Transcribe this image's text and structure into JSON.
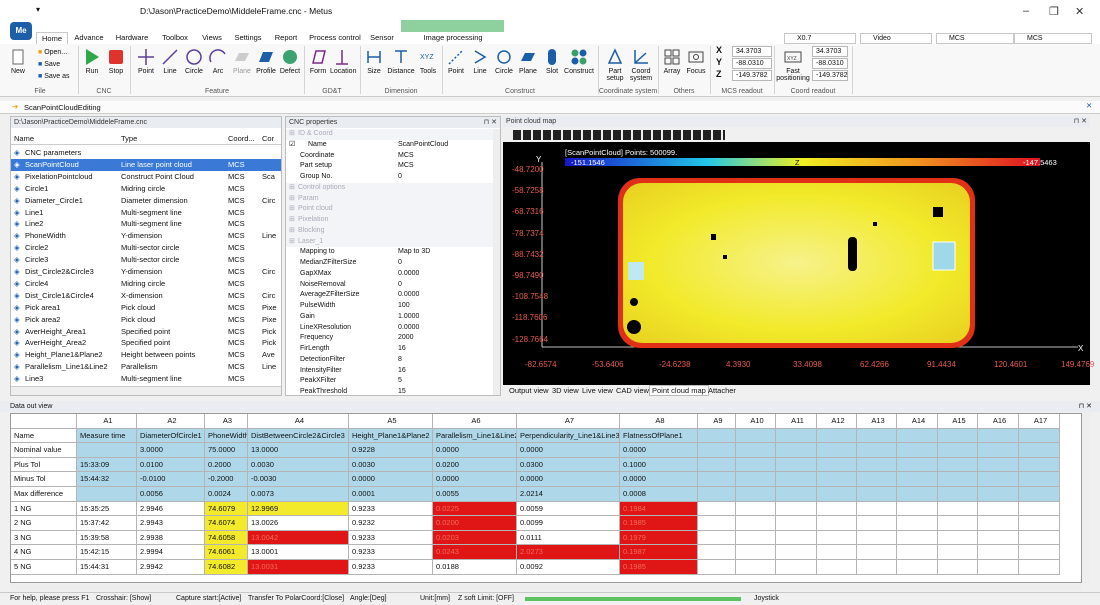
{
  "window": {
    "title": "D:\\Jason\\PracticeDemo\\MiddeleFrame.cnc - Metus",
    "logo": "Me"
  },
  "ribbon_tabs": [
    "Home",
    "Advance",
    "Hardware",
    "Toolbox",
    "Views",
    "Settings",
    "Report",
    "Process control",
    "Sensor",
    "Image processing parameters"
  ],
  "ribbon_groups": {
    "file": {
      "label": "File",
      "buttons": [
        "New",
        "Open...",
        "Save",
        "Save as"
      ]
    },
    "cnc": {
      "label": "CNC",
      "buttons": [
        "Run",
        "Stop"
      ]
    },
    "feature": {
      "label": "Feature",
      "buttons": [
        "Point",
        "Line",
        "Circle",
        "Arc",
        "Plane",
        "Profile",
        "Defect"
      ]
    },
    "gdt": {
      "label": "GD&T",
      "buttons": [
        "Form",
        "Location"
      ]
    },
    "dimension": {
      "label": "Dimension",
      "buttons": [
        "Size",
        "Distance",
        "Tools"
      ]
    },
    "construct": {
      "label": "Construct",
      "buttons": [
        "Point",
        "Line",
        "Circle",
        "Plane",
        "Slot",
        "Construct"
      ]
    },
    "coord": {
      "label": "Coordinate system",
      "buttons": [
        "Part setup",
        "Coord system"
      ]
    },
    "others": {
      "label": "Others",
      "buttons": [
        "Array",
        "Focus"
      ]
    },
    "mcs_readout": {
      "label": "MCS readout",
      "x": "34.3703",
      "y": "-88.0310",
      "z": "-149.3782"
    },
    "coord_readout": {
      "label": "Coord readout",
      "button": "Fast positioning",
      "x": "34.3703",
      "y": "-88.0310",
      "z": "-149.3782"
    }
  },
  "top_selects": {
    "zoom": "X0.7",
    "video": "Video",
    "mcs1": "MCS",
    "mcs2": "MCS"
  },
  "toolbar_item": "ScanPointCloudEditing",
  "tree": {
    "path": "D:\\Jason\\PracticeDemo\\MiddeleFrame.cnc",
    "headers": [
      "Name",
      "Type",
      "Coord...",
      "Cor"
    ],
    "rows": [
      {
        "name": "CNC parameters",
        "type": "",
        "coord": "",
        "cor": ""
      },
      {
        "name": "ScanPointCloud",
        "type": "Line laser point cloud",
        "coord": "MCS",
        "cor": ""
      },
      {
        "name": "PixelationPointcloud",
        "type": "Construct Point Cloud",
        "coord": "MCS",
        "cor": "Sca"
      },
      {
        "name": "Circle1",
        "type": "Midring circle",
        "coord": "MCS",
        "cor": ""
      },
      {
        "name": "Diameter_Circle1",
        "type": "Diameter dimension",
        "coord": "MCS",
        "cor": "Circ"
      },
      {
        "name": "Line1",
        "type": "Multi-segment line",
        "coord": "MCS",
        "cor": ""
      },
      {
        "name": "Line2",
        "type": "Multi-segment line",
        "coord": "MCS",
        "cor": ""
      },
      {
        "name": "PhoneWidth",
        "type": "Y-dimension",
        "coord": "MCS",
        "cor": "Line"
      },
      {
        "name": "Circle2",
        "type": "Multi-sector circle",
        "coord": "MCS",
        "cor": ""
      },
      {
        "name": "Circle3",
        "type": "Multi-sector circle",
        "coord": "MCS",
        "cor": ""
      },
      {
        "name": "Dist_Circle2&Circle3",
        "type": "Y-dimension",
        "coord": "MCS",
        "cor": "Circ"
      },
      {
        "name": "Circle4",
        "type": "Midring circle",
        "coord": "MCS",
        "cor": ""
      },
      {
        "name": "Dist_Circle1&Circle4",
        "type": "X-dimension",
        "coord": "MCS",
        "cor": "Circ"
      },
      {
        "name": "Pick area1",
        "type": "Pick cloud",
        "coord": "MCS",
        "cor": "Pixe"
      },
      {
        "name": "Pick area2",
        "type": "Pick cloud",
        "coord": "MCS",
        "cor": "Pixe"
      },
      {
        "name": "AverHeight_Area1",
        "type": "Specified point",
        "coord": "MCS",
        "cor": "Pick"
      },
      {
        "name": "AverHeight_Area2",
        "type": "Specified point",
        "coord": "MCS",
        "cor": "Pick"
      },
      {
        "name": "Height_Plane1&Plane2",
        "type": "Height between points",
        "coord": "MCS",
        "cor": "Ave"
      },
      {
        "name": "Parallelism_Line1&Line2",
        "type": "Parallelism",
        "coord": "MCS",
        "cor": "Line"
      },
      {
        "name": "Line3",
        "type": "Multi-segment line",
        "coord": "MCS",
        "cor": ""
      }
    ]
  },
  "props": {
    "title": "CNC properties",
    "rows": [
      {
        "k": "ID & Coord",
        "v": "",
        "cat": true
      },
      {
        "k": "Name",
        "v": "ScanPointCloud",
        "cat": false
      },
      {
        "k": "Coordinate",
        "v": "MCS",
        "cat": false
      },
      {
        "k": "Part setup",
        "v": "MCS",
        "cat": false
      },
      {
        "k": "Group No.",
        "v": "0",
        "cat": false
      },
      {
        "k": "Control options",
        "v": "",
        "cat": true
      },
      {
        "k": "Param",
        "v": "",
        "cat": true
      },
      {
        "k": "Point cloud",
        "v": "",
        "cat": true
      },
      {
        "k": "Pixelation",
        "v": "",
        "cat": true
      },
      {
        "k": "Blocking",
        "v": "",
        "cat": true
      },
      {
        "k": "Laser_1",
        "v": "",
        "cat": true
      },
      {
        "k": "Mapping to",
        "v": "Map to 3D",
        "cat": false
      },
      {
        "k": "MedianZFilterSize",
        "v": "0",
        "cat": false
      },
      {
        "k": "GapXMax",
        "v": "0.0000",
        "cat": false
      },
      {
        "k": "NoiseRemoval",
        "v": "0",
        "cat": false
      },
      {
        "k": "AverageZFilterSize",
        "v": "0.0000",
        "cat": false
      },
      {
        "k": "PulseWidth",
        "v": "100",
        "cat": false
      },
      {
        "k": "Gain",
        "v": "1.0000",
        "cat": false
      },
      {
        "k": "LineXResolution",
        "v": "0.0000",
        "cat": false
      },
      {
        "k": "Frequency",
        "v": "2000",
        "cat": false
      },
      {
        "k": "FirLength",
        "v": "16",
        "cat": false
      },
      {
        "k": "DetectionFilter",
        "v": "8",
        "cat": false
      },
      {
        "k": "IntensityFilter",
        "v": "16",
        "cat": false
      },
      {
        "k": "PeakXFilter",
        "v": "5",
        "cat": false
      },
      {
        "k": "PeakThreshold",
        "v": "15",
        "cat": false
      }
    ]
  },
  "pointcloud": {
    "title": "Point cloud map",
    "label": "[ScanPointCloud] Points: 500099.",
    "min": "-151.1546",
    "mid": "Z",
    "max": "-147.5463",
    "y_ticks": [
      "-48.7200",
      "-58.7258",
      "-68.7316",
      "-78.7374",
      "-88.7432",
      "-98.7490",
      "-108.7548",
      "-118.7606",
      "-128.7664"
    ],
    "x_ticks": [
      "-82.6574",
      "-53.6406",
      "-24.6238",
      "4.3930",
      "33.4098",
      "62.4266",
      "91.4434",
      "120.4601",
      "149.4769"
    ],
    "y_axis": "Y",
    "x_axis": "X"
  },
  "view_tabs": [
    "Output view",
    "3D view",
    "Live view",
    "CAD view",
    "Point cloud map",
    "Attacher"
  ],
  "dataout": {
    "title": "Data out view",
    "cols": [
      "",
      "A1",
      "A2",
      "A3",
      "A4",
      "A5",
      "A6",
      "A7",
      "A8",
      "A9",
      "A10",
      "A11",
      "A12",
      "A13",
      "A14",
      "A15",
      "A16",
      "A17"
    ],
    "rows": [
      [
        "Name",
        "Measure time",
        "DiameterOfCircle1",
        "PhoneWidth",
        "DistBetweenCircle2&Circle3",
        "Height_Plane1&Plane2",
        "Parallelism_Line1&Line2",
        "Perpendicularity_Line1&Line3",
        "FlatnessOfPlane1"
      ],
      [
        "Nominal value",
        "",
        "3.0000",
        "75.0000",
        "13.0000",
        "0.9228",
        "0.0000",
        "0.0000",
        "0.0000"
      ],
      [
        "Plus Tol",
        "15:33:09",
        "0.0100",
        "0.2000",
        "0.0030",
        "0.0030",
        "0.0200",
        "0.0300",
        "0.1000"
      ],
      [
        "Minus Tol",
        "15:44:32",
        "-0.0100",
        "-0.2000",
        "-0.0030",
        "0.0000",
        "0.0000",
        "0.0000",
        "0.0000"
      ],
      [
        "Max difference",
        "",
        "0.0056",
        "0.0024",
        "0.0073",
        "0.0001",
        "0.0055",
        "2.0214",
        "0.0008"
      ],
      [
        "1  NG",
        "15:35:25",
        "2.9946",
        "74.6079",
        "12.9969",
        "0.9233",
        "0.0225",
        "0.0059",
        "0.1984"
      ],
      [
        "2  NG",
        "15:37:42",
        "2.9943",
        "74.6074",
        "13.0026",
        "0.9232",
        "0.0200",
        "0.0099",
        "0.1985"
      ],
      [
        "3  NG",
        "15:39:58",
        "2.9938",
        "74.6058",
        "13.0042",
        "0.9233",
        "0.0203",
        "0.0111",
        "0.1979"
      ],
      [
        "4  NG",
        "15:42:15",
        "2.9994",
        "74.6061",
        "13.0001",
        "0.9233",
        "0.0243",
        "2.0273",
        "0.1987"
      ],
      [
        "5  NG",
        "15:44:31",
        "2.9942",
        "74.6082",
        "13.0031",
        "0.9233",
        "0.0188",
        "0.0092",
        "0.1985"
      ]
    ],
    "colors": {
      "header_blue": "#aed8ea",
      "yellow": "#f2ea2a",
      "red": "#e01616",
      "white": "#ffffff"
    }
  },
  "status": [
    "For help, please press F1",
    "Crosshair: [Show]",
    "Capture start:[Active]",
    "Transfer To PolarCoord:[Close]",
    "Angle:[Deg]",
    "Unit:[mm]",
    "Z soft Limit: [OFF]",
    "Joystick"
  ]
}
